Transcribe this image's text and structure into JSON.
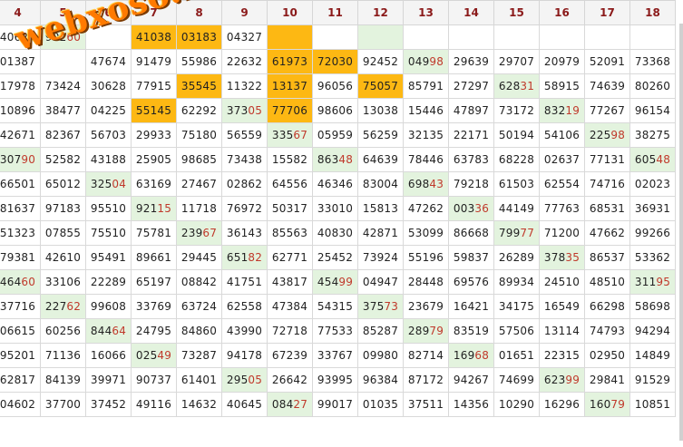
{
  "brand": "webxoso.net",
  "columns": [
    "4",
    "5",
    "6",
    "7",
    "8",
    "9",
    "10",
    "11",
    "12",
    "13",
    "14",
    "15",
    "16",
    "17",
    "18"
  ],
  "rows": [
    [
      [
        "40627",
        ""
      ],
      [
        "90260",
        "gr"
      ],
      [
        "",
        ""
      ],
      [
        "41038",
        "hl"
      ],
      [
        "03183",
        "hl"
      ],
      [
        "04327",
        ""
      ],
      [
        "",
        "hl"
      ],
      [
        "",
        ""
      ],
      [
        "",
        "gr"
      ],
      [
        "",
        ""
      ],
      [
        "",
        ""
      ],
      [
        "",
        ""
      ],
      [
        "",
        ""
      ],
      [
        "",
        ""
      ],
      [
        "",
        ""
      ]
    ],
    [
      [
        "01387",
        ""
      ],
      [
        "",
        ""
      ],
      [
        "47674",
        ""
      ],
      [
        "91479",
        ""
      ],
      [
        "55986",
        ""
      ],
      [
        "22632",
        ""
      ],
      [
        "61973",
        "hl"
      ],
      [
        "72030",
        "hl"
      ],
      [
        "92452",
        ""
      ],
      [
        "04998",
        "gr"
      ],
      [
        "29639",
        ""
      ],
      [
        "29707",
        ""
      ],
      [
        "20979",
        ""
      ],
      [
        "52091",
        ""
      ],
      [
        "73368",
        ""
      ]
    ],
    [
      [
        "17978",
        ""
      ],
      [
        "73424",
        ""
      ],
      [
        "30628",
        ""
      ],
      [
        "77915",
        ""
      ],
      [
        "35545",
        "hl"
      ],
      [
        "11322",
        ""
      ],
      [
        "13137",
        "hl"
      ],
      [
        "96056",
        ""
      ],
      [
        "75057",
        "hl"
      ],
      [
        "85791",
        ""
      ],
      [
        "27297",
        ""
      ],
      [
        "62831",
        "gr"
      ],
      [
        "58915",
        ""
      ],
      [
        "74639",
        ""
      ],
      [
        "80260",
        ""
      ]
    ],
    [
      [
        "10896",
        ""
      ],
      [
        "38477",
        ""
      ],
      [
        "04225",
        ""
      ],
      [
        "55145",
        "hl"
      ],
      [
        "62292",
        ""
      ],
      [
        "37305",
        "gr"
      ],
      [
        "77706",
        "hl"
      ],
      [
        "98606",
        ""
      ],
      [
        "13038",
        ""
      ],
      [
        "15446",
        ""
      ],
      [
        "47897",
        ""
      ],
      [
        "73172",
        ""
      ],
      [
        "83219",
        "gr"
      ],
      [
        "77267",
        ""
      ],
      [
        "96154",
        ""
      ]
    ],
    [
      [
        "42671",
        ""
      ],
      [
        "82367",
        ""
      ],
      [
        "56703",
        ""
      ],
      [
        "29933",
        ""
      ],
      [
        "75180",
        ""
      ],
      [
        "56559",
        ""
      ],
      [
        "33567",
        "gr"
      ],
      [
        "05959",
        ""
      ],
      [
        "56259",
        ""
      ],
      [
        "32135",
        ""
      ],
      [
        "22171",
        ""
      ],
      [
        "50194",
        ""
      ],
      [
        "54106",
        ""
      ],
      [
        "22598",
        "gr"
      ],
      [
        "38275",
        ""
      ]
    ],
    [
      [
        "30790",
        "gr"
      ],
      [
        "52582",
        ""
      ],
      [
        "43188",
        ""
      ],
      [
        "25905",
        ""
      ],
      [
        "98685",
        ""
      ],
      [
        "73438",
        ""
      ],
      [
        "15582",
        ""
      ],
      [
        "86348",
        "gr"
      ],
      [
        "64639",
        ""
      ],
      [
        "78446",
        ""
      ],
      [
        "63783",
        ""
      ],
      [
        "68228",
        ""
      ],
      [
        "02637",
        ""
      ],
      [
        "77131",
        ""
      ],
      [
        "60548",
        "gr"
      ]
    ],
    [
      [
        "66501",
        ""
      ],
      [
        "65012",
        ""
      ],
      [
        "32504",
        "gr"
      ],
      [
        "63169",
        ""
      ],
      [
        "27467",
        ""
      ],
      [
        "02862",
        ""
      ],
      [
        "64556",
        ""
      ],
      [
        "46346",
        ""
      ],
      [
        "83004",
        ""
      ],
      [
        "69843",
        "gr"
      ],
      [
        "79218",
        ""
      ],
      [
        "61503",
        ""
      ],
      [
        "62554",
        ""
      ],
      [
        "74716",
        ""
      ],
      [
        "02023",
        ""
      ]
    ],
    [
      [
        "81637",
        ""
      ],
      [
        "97183",
        ""
      ],
      [
        "95510",
        ""
      ],
      [
        "92115",
        "gr"
      ],
      [
        "11718",
        ""
      ],
      [
        "76972",
        ""
      ],
      [
        "50317",
        ""
      ],
      [
        "33010",
        ""
      ],
      [
        "15813",
        ""
      ],
      [
        "47262",
        ""
      ],
      [
        "00336",
        "gr"
      ],
      [
        "44149",
        ""
      ],
      [
        "77763",
        ""
      ],
      [
        "68531",
        ""
      ],
      [
        "36931",
        ""
      ]
    ],
    [
      [
        "51323",
        ""
      ],
      [
        "07855",
        ""
      ],
      [
        "75510",
        ""
      ],
      [
        "75781",
        ""
      ],
      [
        "23967",
        "gr"
      ],
      [
        "36143",
        ""
      ],
      [
        "85563",
        ""
      ],
      [
        "40830",
        ""
      ],
      [
        "42871",
        ""
      ],
      [
        "53099",
        ""
      ],
      [
        "86668",
        ""
      ],
      [
        "79977",
        "gr"
      ],
      [
        "71200",
        ""
      ],
      [
        "47662",
        ""
      ],
      [
        "99266",
        ""
      ]
    ],
    [
      [
        "79381",
        ""
      ],
      [
        "42610",
        ""
      ],
      [
        "95491",
        ""
      ],
      [
        "89661",
        ""
      ],
      [
        "29445",
        ""
      ],
      [
        "65182",
        "gr"
      ],
      [
        "62771",
        ""
      ],
      [
        "25452",
        ""
      ],
      [
        "73924",
        ""
      ],
      [
        "55196",
        ""
      ],
      [
        "59837",
        ""
      ],
      [
        "26289",
        ""
      ],
      [
        "37835",
        "gr"
      ],
      [
        "86537",
        ""
      ],
      [
        "53362",
        ""
      ]
    ],
    [
      [
        "46460",
        "gr"
      ],
      [
        "33106",
        ""
      ],
      [
        "22289",
        ""
      ],
      [
        "65197",
        ""
      ],
      [
        "08842",
        ""
      ],
      [
        "41751",
        ""
      ],
      [
        "43817",
        ""
      ],
      [
        "45499",
        "gr"
      ],
      [
        "04947",
        ""
      ],
      [
        "28448",
        ""
      ],
      [
        "69576",
        ""
      ],
      [
        "89934",
        ""
      ],
      [
        "24510",
        ""
      ],
      [
        "48510",
        ""
      ],
      [
        "31195",
        "gr"
      ]
    ],
    [
      [
        "37716",
        ""
      ],
      [
        "22762",
        "gr"
      ],
      [
        "99608",
        ""
      ],
      [
        "33769",
        ""
      ],
      [
        "63724",
        ""
      ],
      [
        "62558",
        ""
      ],
      [
        "47384",
        ""
      ],
      [
        "54315",
        ""
      ],
      [
        "37573",
        "gr"
      ],
      [
        "23679",
        ""
      ],
      [
        "16421",
        ""
      ],
      [
        "34175",
        ""
      ],
      [
        "16549",
        ""
      ],
      [
        "66298",
        ""
      ],
      [
        "58698",
        ""
      ]
    ],
    [
      [
        "06615",
        ""
      ],
      [
        "60256",
        ""
      ],
      [
        "84464",
        "gr"
      ],
      [
        "24795",
        ""
      ],
      [
        "84860",
        ""
      ],
      [
        "43990",
        ""
      ],
      [
        "72718",
        ""
      ],
      [
        "77533",
        ""
      ],
      [
        "85287",
        ""
      ],
      [
        "28979",
        "gr"
      ],
      [
        "83519",
        ""
      ],
      [
        "57506",
        ""
      ],
      [
        "13114",
        ""
      ],
      [
        "74793",
        ""
      ],
      [
        "94294",
        ""
      ]
    ],
    [
      [
        "95201",
        ""
      ],
      [
        "71136",
        ""
      ],
      [
        "16066",
        ""
      ],
      [
        "02549",
        "gr"
      ],
      [
        "73287",
        ""
      ],
      [
        "94178",
        ""
      ],
      [
        "67239",
        ""
      ],
      [
        "33767",
        ""
      ],
      [
        "09980",
        ""
      ],
      [
        "82714",
        ""
      ],
      [
        "16968",
        "gr"
      ],
      [
        "01651",
        ""
      ],
      [
        "22315",
        ""
      ],
      [
        "02950",
        ""
      ],
      [
        "14849",
        ""
      ]
    ],
    [
      [
        "62817",
        ""
      ],
      [
        "84139",
        ""
      ],
      [
        "39971",
        ""
      ],
      [
        "90737",
        ""
      ],
      [
        "61401",
        ""
      ],
      [
        "29505",
        "gr"
      ],
      [
        "26642",
        ""
      ],
      [
        "93995",
        ""
      ],
      [
        "96384",
        ""
      ],
      [
        "87172",
        ""
      ],
      [
        "94267",
        ""
      ],
      [
        "74699",
        ""
      ],
      [
        "62399",
        "gr"
      ],
      [
        "29841",
        ""
      ],
      [
        "91529",
        ""
      ]
    ],
    [
      [
        "04602",
        ""
      ],
      [
        "37700",
        ""
      ],
      [
        "37452",
        ""
      ],
      [
        "49116",
        ""
      ],
      [
        "14632",
        ""
      ],
      [
        "40645",
        ""
      ],
      [
        "08427",
        "gr"
      ],
      [
        "99017",
        ""
      ],
      [
        "01035",
        ""
      ],
      [
        "37511",
        ""
      ],
      [
        "14356",
        ""
      ],
      [
        "10290",
        ""
      ],
      [
        "16296",
        ""
      ],
      [
        "16079",
        "gr"
      ],
      [
        "10851",
        ""
      ]
    ]
  ]
}
